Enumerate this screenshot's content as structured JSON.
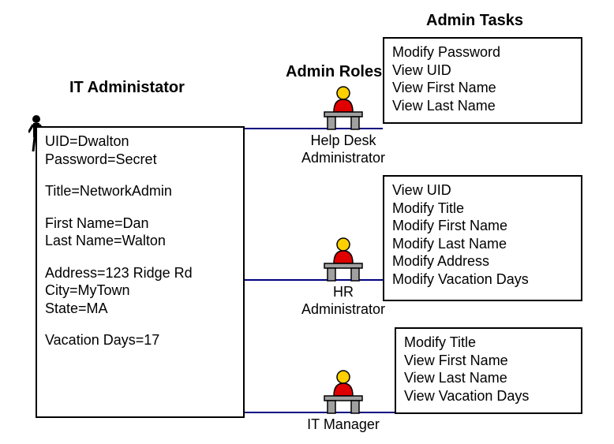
{
  "headings": {
    "left": "IT Administator",
    "roles": "Admin Roles",
    "tasks": "Admin Tasks"
  },
  "admin_box": {
    "uid": "UID=Dwalton",
    "password": "Password=Secret",
    "title": "Title=NetworkAdmin",
    "first_name": "First Name=Dan",
    "last_name": "Last Name=Walton",
    "address": "Address=123 Ridge Rd",
    "city": "City=MyTown",
    "state": "State=MA",
    "vacation": "Vacation Days=17"
  },
  "roles": {
    "helpdesk": {
      "label1": "Help  Desk",
      "label2": "Administrator",
      "tasks": {
        "t1": "Modify Password",
        "t2": "View UID",
        "t3": "View First Name",
        "t4": "View Last Name"
      }
    },
    "hr": {
      "label1": "HR",
      "label2": "Administrator",
      "tasks": {
        "t1": "View UID",
        "t2": "Modify Title",
        "t3": "Modify First Name",
        "t4": "Modify Last Name",
        "t5": "Modify Address",
        "t6": "Modify Vacation Days"
      }
    },
    "it": {
      "label1": "IT Manager",
      "tasks": {
        "t1": "Modify Title",
        "t2": "View First Name",
        "t3": "View Last Name",
        "t4": "View Vacation Days"
      }
    }
  }
}
